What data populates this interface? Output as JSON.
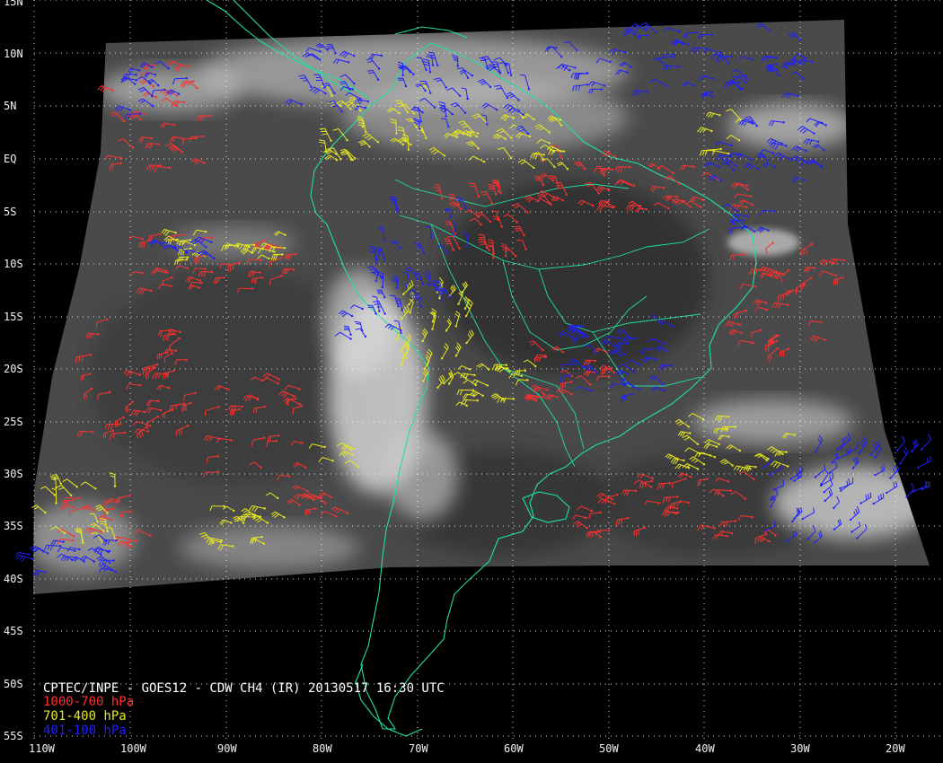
{
  "map": {
    "title": "CPTEC/INPE - GOES12 - CDW CH4 (IR) 20130517 16:30 UTC",
    "legend": [
      {
        "label": "1000-700 hPa",
        "color": "#ff3030"
      },
      {
        "label": "701-400 hPa",
        "color": "#e8e820"
      },
      {
        "label": "401-100 hPa",
        "color": "#2020ff"
      }
    ],
    "lat_labels": [
      "15N",
      "10N",
      "5N",
      "EQ",
      "5S",
      "10S",
      "15S",
      "20S",
      "25S",
      "30S",
      "35S",
      "40S",
      "45S",
      "50S",
      "55S"
    ],
    "lon_labels": [
      "110W",
      "100W",
      "90W",
      "80W",
      "70W",
      "60W",
      "50W",
      "40W",
      "30W",
      "20W"
    ],
    "colors": {
      "background": "#000000",
      "imagery_gray": "#4d4d4d",
      "grid": "#ffffff",
      "coastline": "#20e0a0",
      "low_level": "#ff3030",
      "mid_level": "#e8e820",
      "high_level": "#2020ff"
    }
  }
}
